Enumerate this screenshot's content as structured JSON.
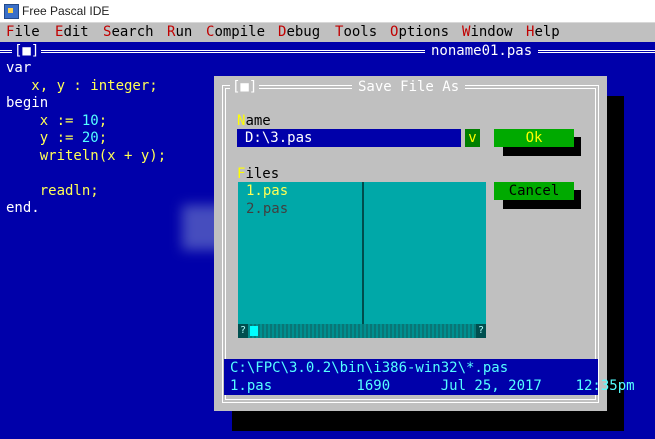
{
  "window": {
    "title": "Free Pascal IDE"
  },
  "menu": [
    {
      "hot": "F",
      "rest": "ile"
    },
    {
      "hot": "E",
      "rest": "dit"
    },
    {
      "hot": "S",
      "rest": "earch"
    },
    {
      "hot": "R",
      "rest": "un"
    },
    {
      "hot": "C",
      "rest": "ompile"
    },
    {
      "hot": "D",
      "rest": "ebug"
    },
    {
      "hot": "T",
      "rest": "ools"
    },
    {
      "hot": "O",
      "rest": "ptions"
    },
    {
      "hot": "W",
      "rest": "indow"
    },
    {
      "hot": "H",
      "rest": "elp"
    }
  ],
  "editor": {
    "title": "noname01.pas",
    "close_glyph": "[■]",
    "code": [
      [
        {
          "t": "var",
          "c": "kw"
        }
      ],
      [
        {
          "t": "   x, y : integer;",
          "c": ""
        }
      ],
      [
        {
          "t": "begin",
          "c": "kw"
        }
      ],
      [
        {
          "t": "    x := ",
          "c": ""
        },
        {
          "t": "10",
          "c": "num"
        },
        {
          "t": ";",
          "c": ""
        }
      ],
      [
        {
          "t": "    y := ",
          "c": ""
        },
        {
          "t": "20",
          "c": "num"
        },
        {
          "t": ";",
          "c": ""
        }
      ],
      [
        {
          "t": "    writeln(x + y);",
          "c": ""
        }
      ],
      [
        {
          "t": "",
          "c": ""
        }
      ],
      [
        {
          "t": "    readln;",
          "c": ""
        }
      ],
      [
        {
          "t": "end.",
          "c": "kw"
        }
      ]
    ]
  },
  "dialog": {
    "title": "Save File As",
    "close_glyph": "[■]",
    "name_label": {
      "hot": "N",
      "rest": "ame"
    },
    "name_value": "D:\\3.pas",
    "dropdown_glyph": "v",
    "ok_label": "Ok",
    "cancel_label": "Cancel",
    "files_label": {
      "hot": "F",
      "rest": "iles"
    },
    "files": [
      {
        "name": "1.pas",
        "selected": true
      },
      {
        "name": "2.pas",
        "selected": false
      }
    ],
    "scroll_left": "?",
    "scroll_right": "?",
    "info_path": "C:\\FPC\\3.0.2\\bin\\i386-win32\\*.pas",
    "info_file": "1.pas          1690      Jul 25, 2017    12:35pm"
  },
  "colors": {
    "desktop": "#0000aa",
    "dialog_bg": "#c0c0c0",
    "button": "#00aa00",
    "list": "#00a8a8"
  }
}
